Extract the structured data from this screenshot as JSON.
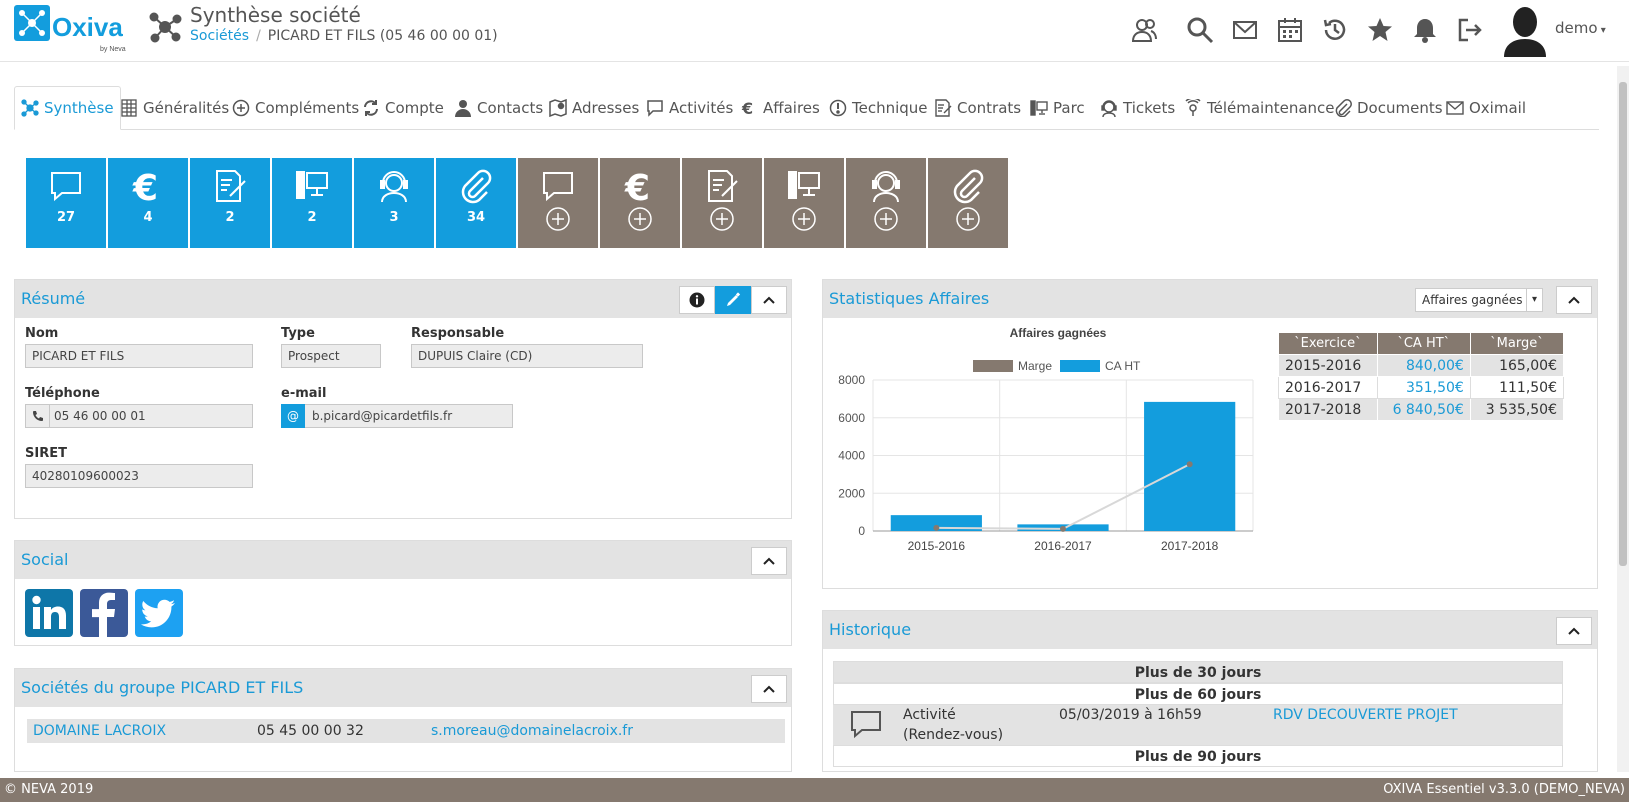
{
  "header": {
    "logo_text": "Oxiva",
    "logo_sub": "by Neva",
    "page_title": "Synthèse société",
    "breadcrumb": {
      "root": "Sociétés",
      "separator": "/",
      "current": "PICARD ET FILS (05 46 00 00 01)"
    },
    "icons": [
      "users-icon",
      "search-icon",
      "mail-icon",
      "calendar-icon",
      "history-icon",
      "star-icon",
      "bell-icon",
      "logout-icon"
    ],
    "user": "demo"
  },
  "tabs": [
    {
      "label": "Synthèse",
      "icon": "network-icon",
      "active": true
    },
    {
      "label": "Généralités",
      "icon": "grid-icon"
    },
    {
      "label": "Compléments",
      "icon": "plus-circle-icon"
    },
    {
      "label": "Compte",
      "icon": "sync-icon"
    },
    {
      "label": "Contacts",
      "icon": "person-icon"
    },
    {
      "label": "Adresses",
      "icon": "map-icon"
    },
    {
      "label": "Activités",
      "icon": "chat-icon"
    },
    {
      "label": "Affaires",
      "icon": "euro-icon"
    },
    {
      "label": "Technique",
      "icon": "exclamation-icon"
    },
    {
      "label": "Contrats",
      "icon": "contract-icon"
    },
    {
      "label": "Parc",
      "icon": "computer-icon"
    },
    {
      "label": "Tickets",
      "icon": "support-icon"
    },
    {
      "label": "Télémaintenance",
      "icon": "remote-icon"
    },
    {
      "label": "Documents",
      "icon": "paperclip-icon"
    },
    {
      "label": "Oximail",
      "icon": "mail-icon"
    }
  ],
  "tiles": {
    "counts": [
      {
        "icon": "chat-icon",
        "value": "27"
      },
      {
        "icon": "euro-icon",
        "value": "4"
      },
      {
        "icon": "contract-icon",
        "value": "2"
      },
      {
        "icon": "computer-icon",
        "value": "2"
      },
      {
        "icon": "support-icon",
        "value": "3"
      },
      {
        "icon": "paperclip-icon",
        "value": "34"
      }
    ],
    "adds": [
      "chat-icon",
      "euro-icon",
      "contract-icon",
      "computer-icon",
      "support-icon",
      "paperclip-icon"
    ],
    "colors": {
      "blue": "#139ddd",
      "grey": "#85796f"
    }
  },
  "resume": {
    "title": "Résumé",
    "nom_label": "Nom",
    "nom": "PICARD ET FILS",
    "type_label": "Type",
    "type": "Prospect",
    "resp_label": "Responsable",
    "resp": "DUPUIS Claire (CD)",
    "tel_label": "Téléphone",
    "tel": "05 46 00 00 01",
    "email_label": "e-mail",
    "email_addon": "@",
    "email": "b.picard@picardetfils.fr",
    "siret_label": "SIRET",
    "siret": "40280109600023"
  },
  "social": {
    "title": "Social",
    "links": [
      "linkedin-icon",
      "facebook-icon",
      "twitter-icon"
    ]
  },
  "groupe": {
    "title": "Sociétés du groupe PICARD ET FILS",
    "rows": [
      {
        "name": "DOMAINE LACROIX",
        "phone": "05 45 00 00 32",
        "email": "s.moreau@domainelacroix.fr"
      }
    ]
  },
  "stats": {
    "title": "Statistiques Affaires",
    "select_value": "Affaires gagnées",
    "table_headers": [
      "`Exercice`",
      "`CA HT`",
      "`Marge`"
    ],
    "table_rows": [
      [
        "2015-2016",
        "840,00€",
        "165,00€"
      ],
      [
        "2016-2017",
        "351,50€",
        "111,50€"
      ],
      [
        "2017-2018",
        "6 840,50€",
        "3 535,50€"
      ]
    ]
  },
  "chart_data": {
    "type": "bar",
    "title": "Affaires gagnées",
    "categories": [
      "2015-2016",
      "2016-2017",
      "2017-2018"
    ],
    "series": [
      {
        "name": "Marge",
        "type": "line",
        "color": "#85796f",
        "values": [
          165,
          111.5,
          3535.5
        ]
      },
      {
        "name": "CA HT",
        "type": "bar",
        "color": "#139ddd",
        "values": [
          840,
          351.5,
          6840.5
        ]
      }
    ],
    "ylim": [
      0,
      8000
    ],
    "yticks": [
      "0",
      "2000",
      "4000",
      "6000",
      "8000"
    ],
    "legend": "top",
    "grid": true
  },
  "historique": {
    "title": "Historique",
    "sections": [
      "Plus de 30 jours",
      "Plus de 60 jours",
      "Plus de 90 jours"
    ],
    "activity": {
      "type_line1": "Activité",
      "type_line2": "(Rendez-vous)",
      "date": "05/03/2019 à 16h59",
      "subject": "RDV DECOUVERTE PROJET"
    }
  },
  "footer": {
    "left": "© NEVA 2019",
    "right": "OXIVA Essentiel v3.3.0 (DEMO_NEVA)"
  }
}
